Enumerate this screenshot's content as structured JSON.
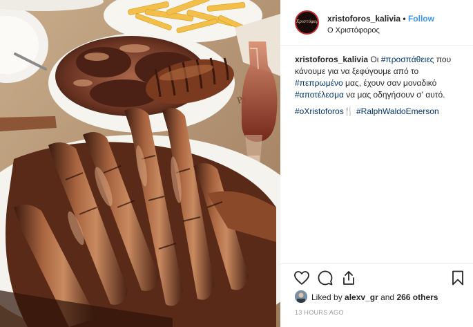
{
  "post": {
    "username": "xristoforos_kalivia",
    "separator": "•",
    "follow_label": "Follow",
    "location": "Ο Χριστόφορος",
    "avatar_logo_text": "Χριστόφορος",
    "caption": {
      "username": "xristoforos_kalivia",
      "t1": " Οι ",
      "tag1": "#προσπάθειες",
      "t2": " που κάνουμε για να ξεφύγουμε από το ",
      "tag2": "#πεπρωμένο",
      "t3": " μας, έχουν σαν μοναδικό ",
      "tag3": "#αποτέλεσμα",
      "t4": " να μας οδηγήσουν σ' αυτό."
    },
    "hashtags": {
      "tag1": "#oXristoforos",
      "cutlery": "🍴",
      "tag2": "#RalphWaldoEmerson"
    },
    "likes": {
      "prefix": "Liked by ",
      "user": "alexv_gr",
      "middle": " and ",
      "count": "266 others"
    },
    "timestamp": "13 HOURS AGO",
    "icons": {
      "like": "heart-icon",
      "comment": "comment-icon",
      "share": "share-icon",
      "save": "bookmark-icon"
    },
    "colors": {
      "link": "#003569",
      "follow": "#3897f0",
      "muted": "#999999",
      "text": "#262626"
    }
  }
}
